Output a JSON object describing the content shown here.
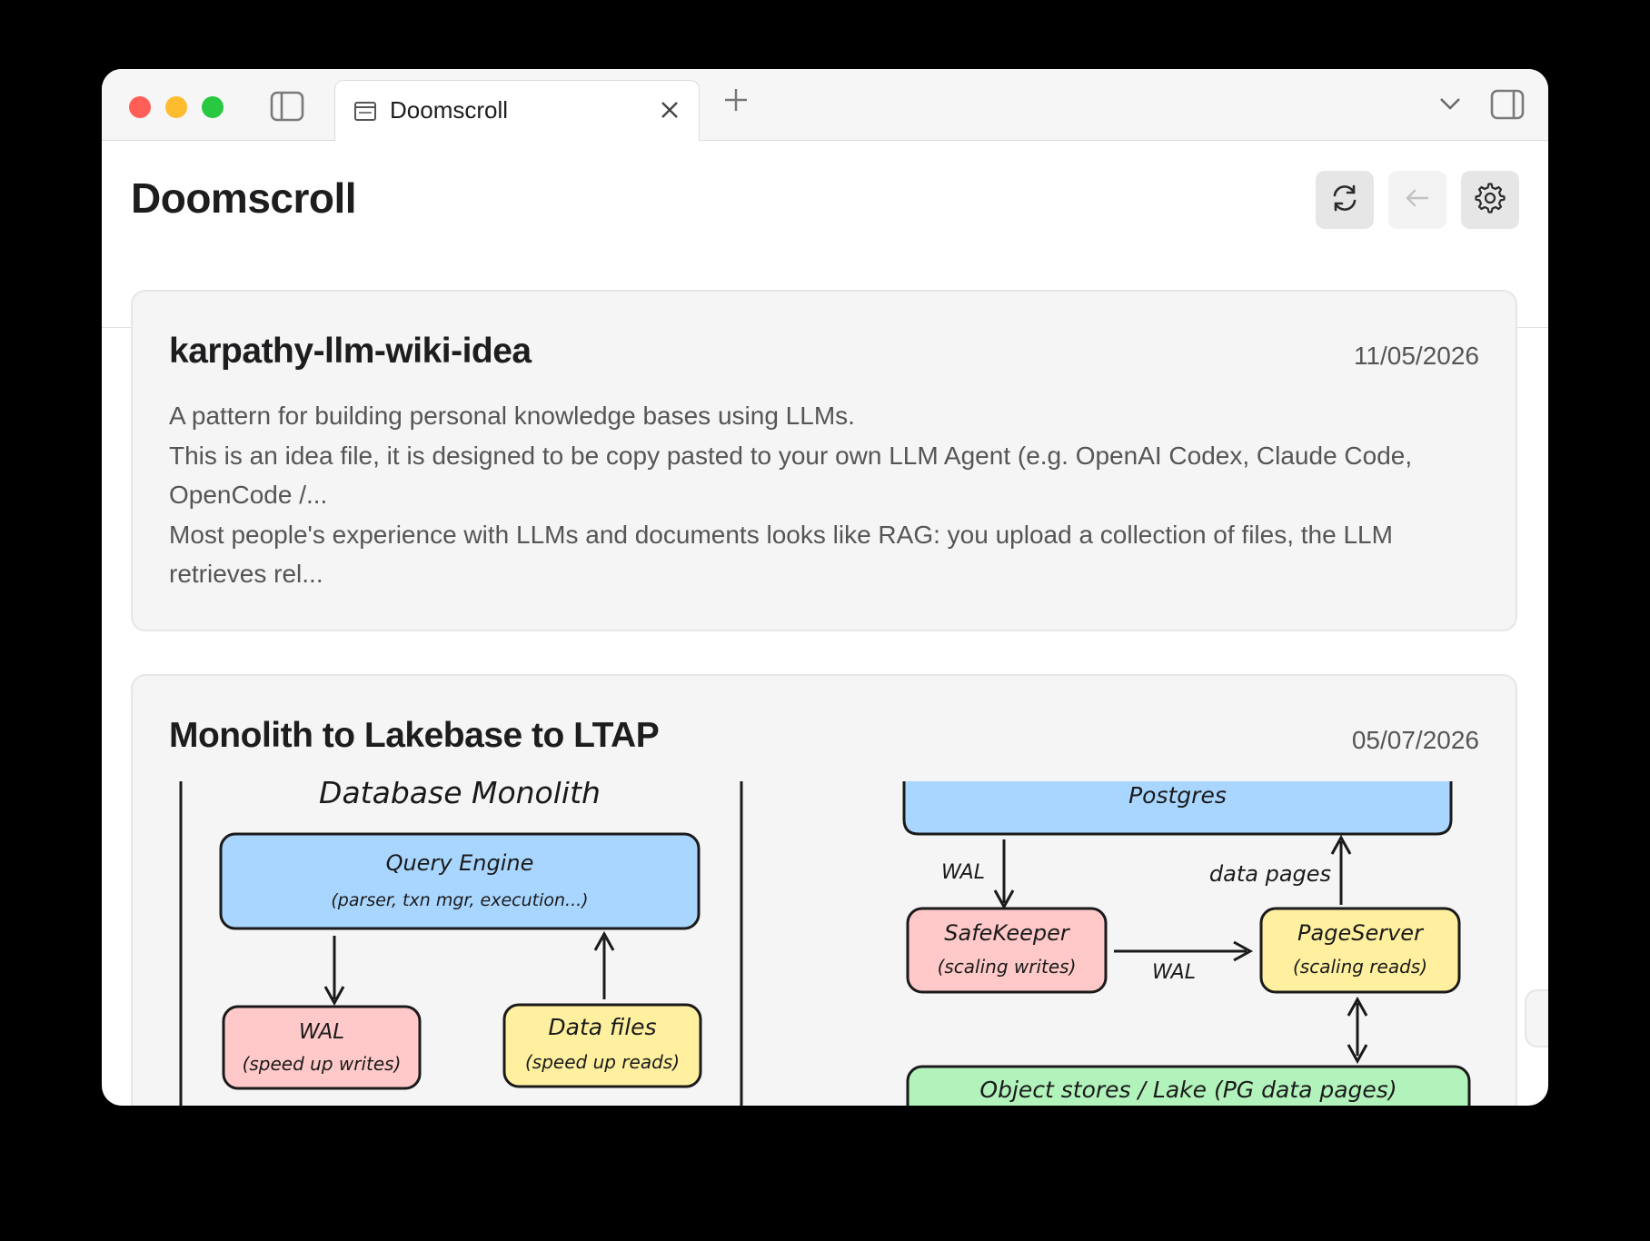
{
  "tab": {
    "title": "Doomscroll"
  },
  "header": {
    "title": "Doomscroll"
  },
  "feed": [
    {
      "title": "karpathy-llm-wiki-idea",
      "date": "11/05/2026",
      "lines": [
        "A pattern for building personal knowledge bases using LLMs.",
        "This is an idea file, it is designed to be copy pasted to your own LLM Agent (e.g. OpenAI Codex, Claude Code, OpenCode /...",
        "Most people's experience with LLMs and documents looks like RAG: you upload a collection of files, the LLM retrieves rel..."
      ]
    },
    {
      "title": "Monolith to Lakebase to LTAP",
      "date": "05/07/2026",
      "diagram": {
        "monolith_title": "Database Monolith",
        "query_engine": "Query Engine",
        "query_engine_sub": "(parser, txn mgr, execution...)",
        "wal": "WAL",
        "wal_sub": "(speed up writes)",
        "data_files": "Data files",
        "data_files_sub": "(speed up reads)",
        "postgres": "Postgres",
        "wal_label_1": "WAL",
        "data_pages_label": "data pages",
        "safekeeper": "SafeKeeper",
        "safekeeper_sub": "(scaling writes)",
        "wal_label_2": "WAL",
        "pageserver": "PageServer",
        "pageserver_sub": "(scaling reads)",
        "object_stores": "Object stores / Lake (PG data pages)"
      }
    }
  ],
  "colors": {
    "blue_box": "#a9d6ff",
    "pink_box": "#ffc9c9",
    "yellow_box": "#fff0a0",
    "green_box": "#b2f2bb"
  },
  "icons": {
    "sidebar_toggle": "sidebar-icon",
    "tab": "window-icon",
    "close": "close-icon",
    "new_tab": "plus-icon",
    "tab_list": "chevron-down-icon",
    "right_sidebar": "right-sidebar-icon",
    "refresh": "refresh-icon",
    "back": "back-arrow-icon",
    "settings": "gear-icon"
  }
}
